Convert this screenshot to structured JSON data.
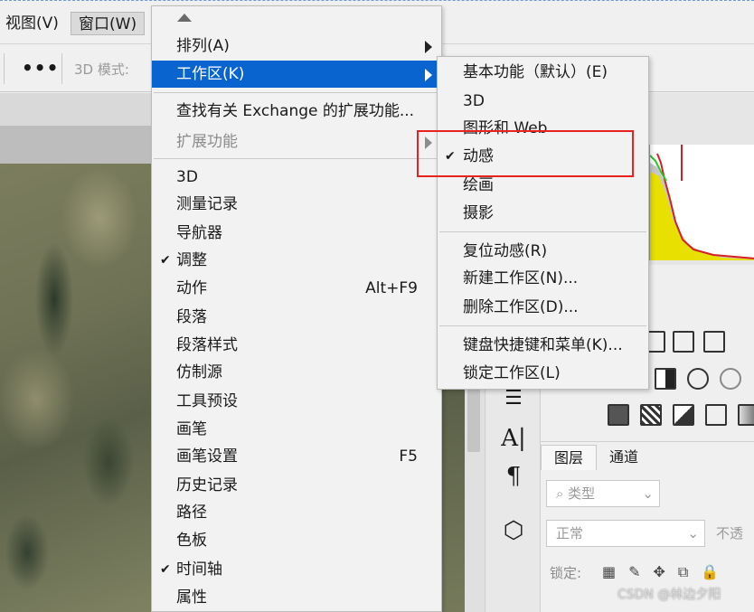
{
  "menubar": {
    "view_label": "视图(V)",
    "window_label": "窗口(W)"
  },
  "optionsbar": {
    "more_label": "•••",
    "mode_3d_label": "3D 模式:"
  },
  "window_menu": {
    "items": [
      {
        "label": "排列(A)",
        "submenu": true
      },
      {
        "label": "工作区(K)",
        "submenu": true,
        "highlighted": true
      },
      {
        "label": "查找有关 Exchange 的扩展功能..."
      },
      {
        "label": "扩展功能",
        "submenu": true,
        "disabled": true
      },
      {
        "label": "3D"
      },
      {
        "label": "测量记录"
      },
      {
        "label": "导航器"
      },
      {
        "label": "调整",
        "checked": true
      },
      {
        "label": "动作",
        "shortcut": "Alt+F9"
      },
      {
        "label": "段落"
      },
      {
        "label": "段落样式"
      },
      {
        "label": "仿制源"
      },
      {
        "label": "工具预设"
      },
      {
        "label": "画笔"
      },
      {
        "label": "画笔设置",
        "shortcut": "F5"
      },
      {
        "label": "历史记录"
      },
      {
        "label": "路径"
      },
      {
        "label": "色板"
      },
      {
        "label": "时间轴",
        "checked": true
      },
      {
        "label": "属性"
      }
    ],
    "check_glyph": "✔"
  },
  "workspace_submenu": {
    "items": [
      {
        "label": "基本功能（默认）(E)"
      },
      {
        "label": "3D"
      },
      {
        "label": "图形和 Web"
      },
      {
        "label": "动感",
        "checked": true
      },
      {
        "label": "绘画"
      },
      {
        "label": "摄影"
      },
      {
        "label": "复位动感(R)"
      },
      {
        "label": "新建工作区(N)..."
      },
      {
        "label": "删除工作区(D)..."
      },
      {
        "label": "键盘快捷键和菜单(K)..."
      },
      {
        "label": "锁定工作区(L)"
      }
    ]
  },
  "layers_panel": {
    "tab_layers": "图层",
    "tab_channels": "通道",
    "kind_label": "类型",
    "blend_mode": "正常",
    "opacity_label": "不透",
    "lock_label": "锁定:"
  },
  "colors": {
    "selection": "#0a64d0",
    "annotation_box": "#e8231f"
  },
  "watermark": "CSDN @林边夕阳"
}
